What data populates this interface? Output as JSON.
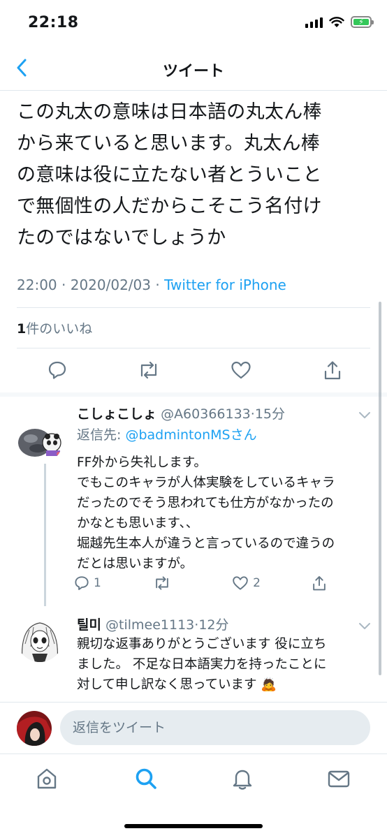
{
  "status_bar": {
    "time": "22:18"
  },
  "header": {
    "title": "ツイート"
  },
  "tweet": {
    "lines": [
      "この丸太の意味は日本語の丸太ん棒",
      "から来ていると思います。丸太ん棒",
      "の意味は役に立たない者とういこと",
      "で無個性の人だからこそこう名付け",
      "たのではないでしょうか"
    ],
    "time": "22:00",
    "date": "2020/02/03",
    "source": "Twitter for iPhone",
    "likes_count": "1",
    "likes_label": "件のいいね"
  },
  "replies": [
    {
      "name": "こしょこしょ",
      "handle": "@A60366133",
      "age": "15分",
      "reply_to_prefix": "返信先: ",
      "reply_to_user": "@badmintonMS",
      "reply_to_suffix": "さん",
      "lines": [
        "FF外から失礼します。",
        "でもこのキャラが人体実験をしているキャラ",
        "だったのでそう思われても仕方がなかったの",
        "かなとも思います、、",
        "堀越先生本人が違うと言っているので違うの",
        "だとは思いますが。"
      ],
      "reply_count": "1",
      "like_count": "2"
    },
    {
      "name": "틸미",
      "handle": "@tilmee1113",
      "age": "12分",
      "lines": [
        "親切な返事ありがとうございます 役に立ち",
        "ました。 不足な日本語実力を持ったことに",
        "対して申し訳なく思っています"
      ],
      "emoji": "🙇"
    }
  ],
  "composer": {
    "placeholder": "返信をツイート"
  },
  "colors": {
    "accent": "#1da1f2",
    "muted": "#657786",
    "text": "#14171a",
    "battery": "#34c759"
  },
  "icons": [
    "back-chevron-icon",
    "reply-icon",
    "retweet-icon",
    "like-icon",
    "share-icon",
    "home-icon",
    "search-icon",
    "notifications-icon",
    "messages-icon"
  ]
}
